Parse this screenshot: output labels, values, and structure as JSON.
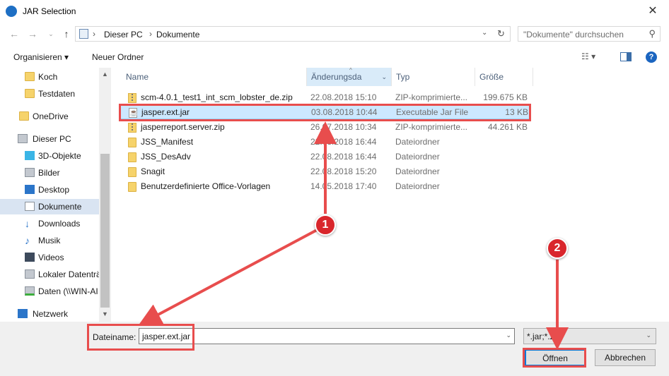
{
  "window": {
    "title": "JAR Selection",
    "close_glyph": "✕"
  },
  "nav": {
    "back": "←",
    "forward": "→",
    "up": "↑",
    "breadcrumbs": [
      "Dieser PC",
      "Dokumente"
    ],
    "search_placeholder": "\"Dokumente\" durchsuchen"
  },
  "toolbar": {
    "organize": "Organisieren ▾",
    "new_folder": "Neuer Ordner"
  },
  "sidebar": {
    "items": [
      {
        "label": "Koch",
        "icon": "folder-icon"
      },
      {
        "label": "Testdaten",
        "icon": "folder-icon"
      },
      {
        "label": "OneDrive",
        "icon": "folder-icon"
      },
      {
        "label": "Dieser PC",
        "icon": "pc-icon"
      },
      {
        "label": "3D-Objekte",
        "icon": "cube-icon"
      },
      {
        "label": "Bilder",
        "icon": "pictures-icon"
      },
      {
        "label": "Desktop",
        "icon": "desktop-icon"
      },
      {
        "label": "Dokumente",
        "icon": "documents-icon"
      },
      {
        "label": "Downloads",
        "icon": "download-icon"
      },
      {
        "label": "Musik",
        "icon": "music-icon"
      },
      {
        "label": "Videos",
        "icon": "video-icon"
      },
      {
        "label": "Lokaler Datenträ",
        "icon": "drive-icon"
      },
      {
        "label": "Daten (\\\\WIN-AI",
        "icon": "network-drive-icon"
      },
      {
        "label": "Netzwerk",
        "icon": "network-icon"
      }
    ]
  },
  "columns": {
    "name": "Name",
    "date": "Änderungsda",
    "type": "Typ",
    "size": "Größe"
  },
  "files": [
    {
      "name": "scm-4.0.1_test1_int_scm_lobster_de.zip",
      "date": "22.08.2018 15:10",
      "type": "ZIP-komprimierte...",
      "size": "199.675 KB",
      "icon": "zip-icon"
    },
    {
      "name": "jasper.ext.jar",
      "date": "03.08.2018 10:44",
      "type": "Executable Jar File",
      "size": "13 KB",
      "icon": "jar-icon"
    },
    {
      "name": "jasperreport.server.zip",
      "date": "26.07.2018 10:34",
      "type": "ZIP-komprimierte...",
      "size": "44.261 KB",
      "icon": "zip-icon"
    },
    {
      "name": "JSS_Manifest",
      "date": "22.08.2018 16:44",
      "type": "Dateiordner",
      "size": "",
      "icon": "folder-icon"
    },
    {
      "name": "JSS_DesAdv",
      "date": "22.08.2018 16:44",
      "type": "Dateiordner",
      "size": "",
      "icon": "folder-icon"
    },
    {
      "name": "Snagit",
      "date": "22.08.2018 15:20",
      "type": "Dateiordner",
      "size": "",
      "icon": "folder-icon"
    },
    {
      "name": "Benutzerdefinierte Office-Vorlagen",
      "date": "14.05.2018 17:40",
      "type": "Dateiordner",
      "size": "",
      "icon": "folder-icon"
    }
  ],
  "footer": {
    "filename_label": "Dateiname:",
    "filename_value": "jasper.ext.jar",
    "filter_value": "*.jar;*.zip",
    "open": "Öffnen",
    "cancel": "Abbrechen"
  },
  "annotations": {
    "badge1": "1",
    "badge2": "2",
    "color": "#e84d4d"
  }
}
